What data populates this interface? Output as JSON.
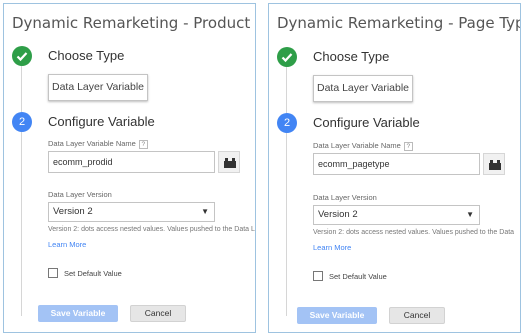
{
  "panels": [
    {
      "title": "Dynamic Remarketing - Product ID",
      "step1_label": "Choose Type",
      "variable_type": "Data Layer Variable",
      "step2_number": "2",
      "step2_label": "Configure Variable",
      "name_field_label": "Data Layer Variable Name",
      "name_field_help": "?",
      "name_field_value": "ecomm_prodid",
      "version_field_label": "Data Layer Version",
      "version_selected": "Version 2",
      "version_hint": "Version 2: dots access nested values. Values pushed to the Data L",
      "learn_more": "Learn More",
      "default_value_label": "Set Default Value",
      "default_value_checked": false,
      "save_label": "Save Variable",
      "cancel_label": "Cancel"
    },
    {
      "title": "Dynamic Remarketing - Page Type",
      "step1_label": "Choose Type",
      "variable_type": "Data Layer Variable",
      "step2_number": "2",
      "step2_label": "Configure Variable",
      "name_field_label": "Data Layer Variable Name",
      "name_field_help": "?",
      "name_field_value": "ecomm_pagetype",
      "version_field_label": "Data Layer Version",
      "version_selected": "Version 2",
      "version_hint": "Version 2: dots access nested values. Values pushed to the Data",
      "learn_more": "Learn More",
      "default_value_label": "Set Default Value",
      "default_value_checked": false,
      "save_label": "Save Variable",
      "cancel_label": "Cancel"
    }
  ],
  "colors": {
    "panel_border": "#9ec3e0",
    "step_done": "#2e9e48",
    "step_active": "#4285f4",
    "link": "#4285f4",
    "save_button": "#a3c3f5",
    "cancel_button": "#e6e6e6"
  },
  "icons": {
    "edit": "pencil-icon",
    "step_done": "checkmark-icon",
    "variable_picker": "brick-icon",
    "dropdown": "caret-down-icon"
  }
}
